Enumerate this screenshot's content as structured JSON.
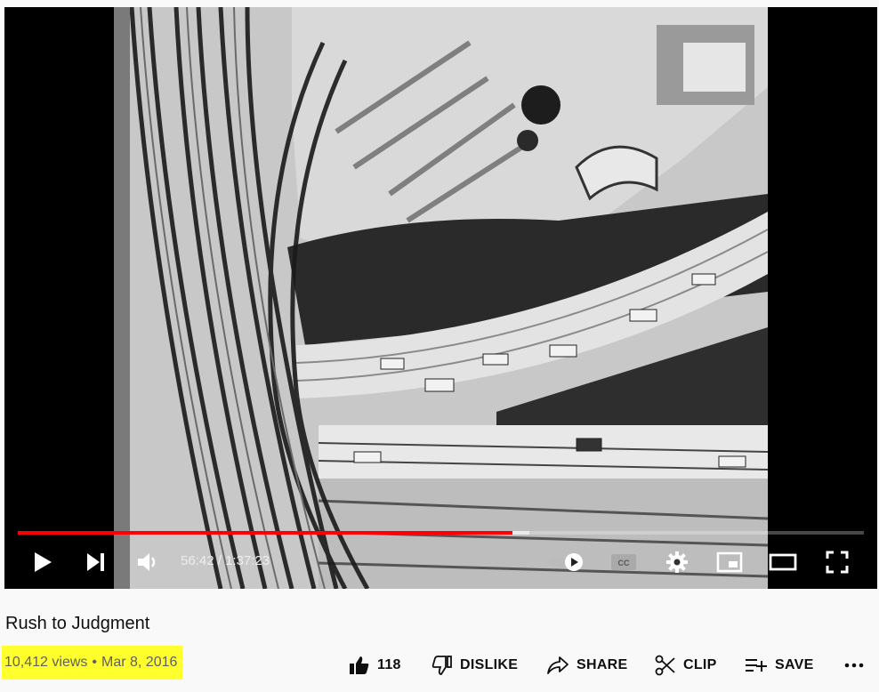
{
  "video": {
    "title": "Rush to Judgment",
    "views": "10,412 views",
    "date": "Mar 8, 2016",
    "separator": "•",
    "highlight_color": "#ffff2e"
  },
  "player": {
    "current_time": "56:42",
    "time_separator": " / ",
    "duration": "1:37:23",
    "played_fraction": 0.585,
    "buffered_fraction": 0.605,
    "progress_color": "#ff0000",
    "autoplay": "on"
  },
  "actions": {
    "like_count": "118",
    "dislike": "DISLIKE",
    "share": "SHARE",
    "clip": "CLIP",
    "save": "SAVE"
  },
  "icons": [
    "play-icon",
    "next-icon",
    "volume-icon",
    "autoplay-toggle-icon",
    "captions-icon",
    "settings-gear-icon",
    "miniplayer-icon",
    "theater-mode-icon",
    "fullscreen-icon",
    "thumbs-up-icon",
    "thumbs-down-icon",
    "share-arrow-icon",
    "scissors-icon",
    "playlist-add-icon",
    "more-icon"
  ]
}
